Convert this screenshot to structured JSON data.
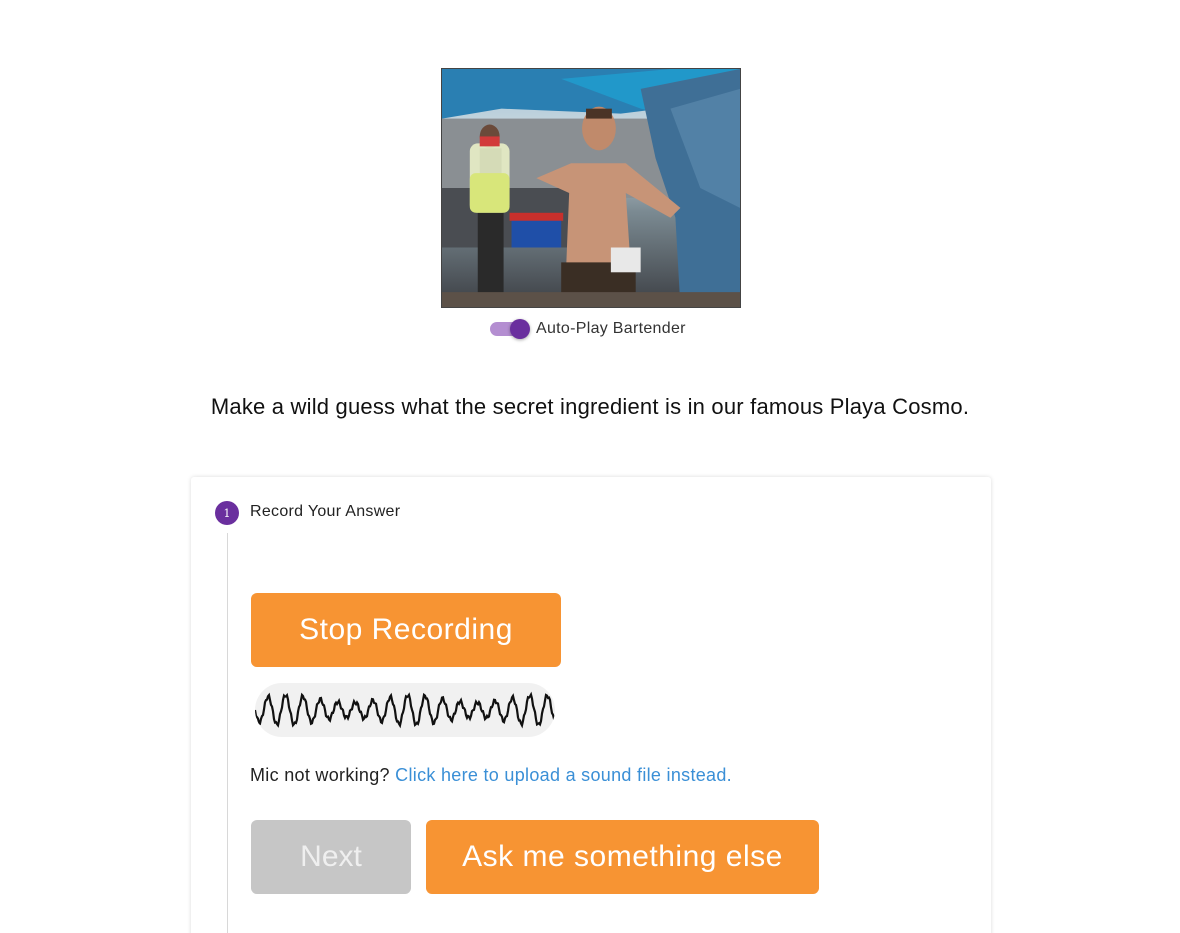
{
  "hero": {
    "image_desc_icon": "bartender-photo",
    "toggle": {
      "label": "Auto-Play Bartender",
      "on": true
    }
  },
  "question": "Make a wild guess what the secret ingredient is in our famous Playa Cosmo.",
  "step": {
    "number": "1",
    "title": "Record Your Answer",
    "stop_label": "Stop Recording",
    "mic_prefix": "Mic not working?",
    "upload_link": "Click here to upload a sound file instead.",
    "next_label": "Next",
    "ask_label": "Ask me something else"
  },
  "colors": {
    "accent": "#6a2f9e",
    "orange": "#f79433",
    "disabled": "#c6c6c6",
    "link": "#3a8fd6"
  }
}
